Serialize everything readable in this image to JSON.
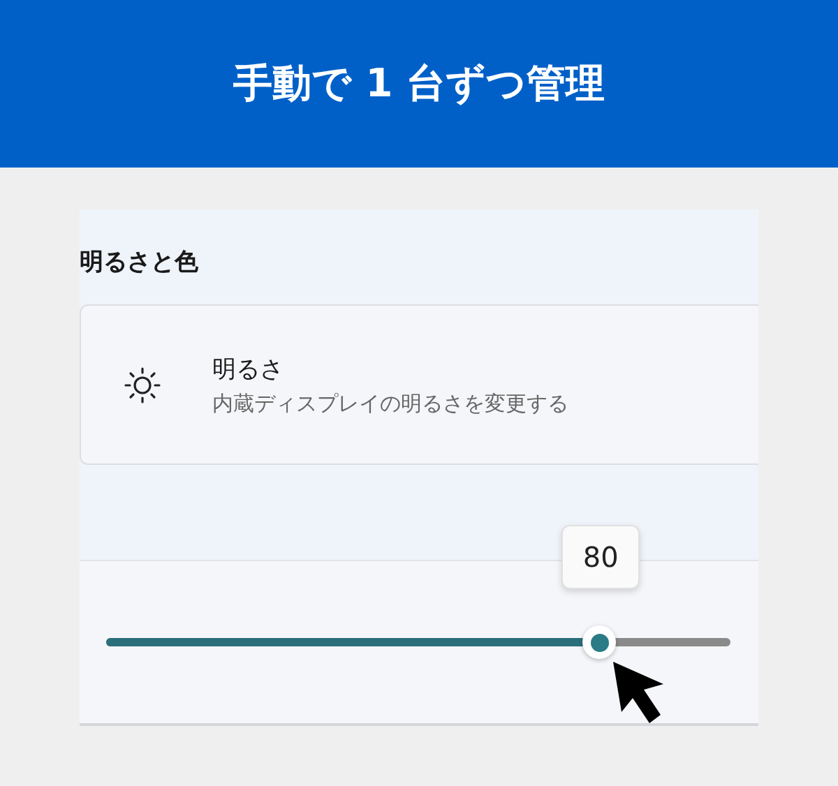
{
  "banner": {
    "title": "手動で 1 台ずつ管理"
  },
  "section": {
    "heading": "明るさと色"
  },
  "setting": {
    "title": "明るさ",
    "description": "内蔵ディスプレイの明るさを変更する"
  },
  "slider": {
    "level": 0.79,
    "tooltip": "80"
  }
}
